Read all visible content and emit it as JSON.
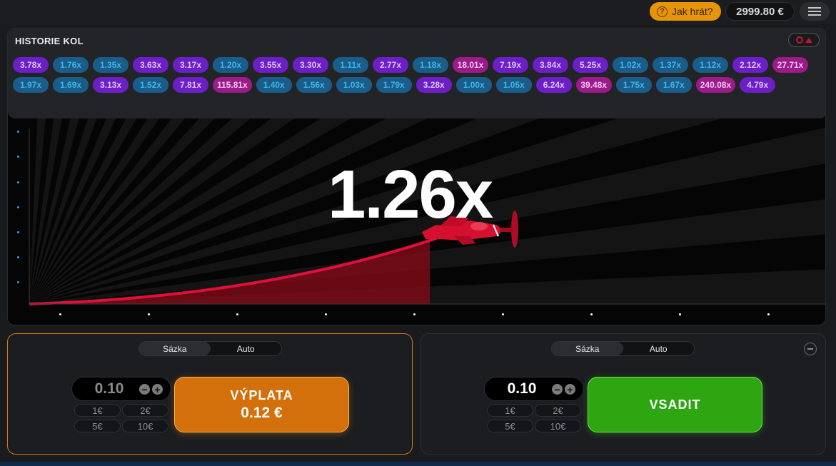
{
  "header": {
    "how_to_play": "Jak hrát?",
    "balance": "2999.80 €"
  },
  "history": {
    "title": "HISTORIE KOL",
    "chips": [
      {
        "v": "3.78x",
        "c": "purple"
      },
      {
        "v": "1.76x",
        "c": "blue"
      },
      {
        "v": "1.35x",
        "c": "blue"
      },
      {
        "v": "3.63x",
        "c": "purple"
      },
      {
        "v": "3.17x",
        "c": "purple"
      },
      {
        "v": "1.20x",
        "c": "blue"
      },
      {
        "v": "3.55x",
        "c": "purple"
      },
      {
        "v": "3.30x",
        "c": "purple"
      },
      {
        "v": "1.11x",
        "c": "blue"
      },
      {
        "v": "2.77x",
        "c": "purple"
      },
      {
        "v": "1.18x",
        "c": "blue"
      },
      {
        "v": "18.01x",
        "c": "pink"
      },
      {
        "v": "7.19x",
        "c": "purple"
      },
      {
        "v": "3.84x",
        "c": "purple"
      },
      {
        "v": "5.25x",
        "c": "purple"
      },
      {
        "v": "1.02x",
        "c": "blue"
      },
      {
        "v": "1.37x",
        "c": "blue"
      },
      {
        "v": "1.12x",
        "c": "blue"
      },
      {
        "v": "2.12x",
        "c": "purple"
      },
      {
        "v": "27.71x",
        "c": "pink"
      },
      {
        "v": "1.97x",
        "c": "blue"
      },
      {
        "v": "1.69x",
        "c": "blue"
      },
      {
        "v": "3.13x",
        "c": "purple"
      },
      {
        "v": "1.52x",
        "c": "blue"
      },
      {
        "v": "7.81x",
        "c": "purple"
      },
      {
        "v": "115.81x",
        "c": "pink"
      },
      {
        "v": "1.40x",
        "c": "blue"
      },
      {
        "v": "1.56x",
        "c": "blue"
      },
      {
        "v": "1.03x",
        "c": "blue"
      },
      {
        "v": "1.79x",
        "c": "blue"
      },
      {
        "v": "3.28x",
        "c": "purple"
      },
      {
        "v": "1.00x",
        "c": "blue"
      },
      {
        "v": "1.05x",
        "c": "blue"
      },
      {
        "v": "6.24x",
        "c": "purple"
      },
      {
        "v": "39.48x",
        "c": "pink"
      },
      {
        "v": "1.75x",
        "c": "blue"
      },
      {
        "v": "1.67x",
        "c": "blue"
      },
      {
        "v": "240.08x",
        "c": "pink"
      },
      {
        "v": "4.79x",
        "c": "purple"
      }
    ]
  },
  "game": {
    "multiplier": "1.26x"
  },
  "bet_left": {
    "tab_bet": "Sázka",
    "tab_auto": "Auto",
    "stake": "0.10",
    "quick": [
      "1€",
      "2€",
      "5€",
      "10€"
    ],
    "button_line1": "VÝPLATA",
    "button_line2": "0.12 €"
  },
  "bet_right": {
    "tab_bet": "Sázka",
    "tab_auto": "Auto",
    "stake": "0.10",
    "quick": [
      "1€",
      "2€",
      "5€",
      "10€"
    ],
    "button_label": "VSADIT"
  },
  "colors": {
    "accent_orange": "#d4700b",
    "accent_green": "#2da612",
    "curve_red": "#e0103a"
  }
}
